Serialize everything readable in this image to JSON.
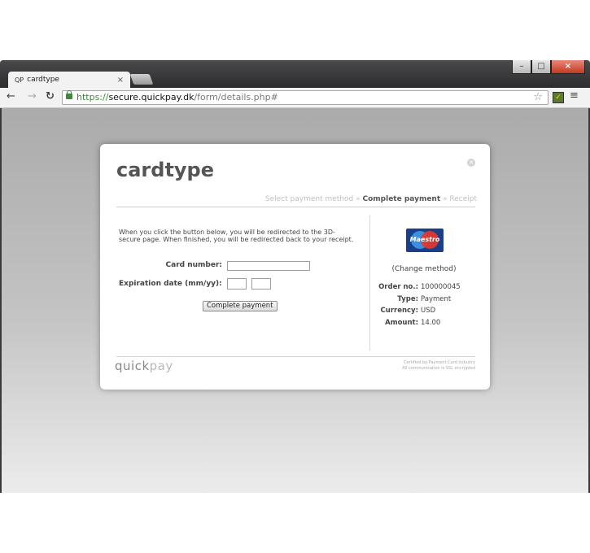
{
  "browser": {
    "tab_title": "cardtype",
    "tab_favicon": "QP",
    "tab_close": "×",
    "url_scheme": "https://",
    "url_host": "secure.quickpay.dk",
    "url_path": "/form/details.php#",
    "icons": [
      "back-arrow-icon",
      "forward-arrow-icon",
      "reload-icon",
      "lock-icon",
      "star-icon",
      "extension-icon",
      "menu-icon"
    ],
    "win_min": "–",
    "win_max": "□",
    "win_close": "×"
  },
  "dialog": {
    "title": "cardtype",
    "steps": {
      "step1": "Select payment method",
      "sep1": " » ",
      "step2": "Complete payment",
      "sep2": " » ",
      "step3": "Receipt"
    },
    "intro": "When you click the button below, you will be redirected to the 3D-secure page. When finished, you will be redirected back to your receipt.",
    "card_number_label": "Card number:",
    "expiration_label": "Expiration date (mm/yy):",
    "submit_label": "Complete payment",
    "card_brand": "Maestro",
    "change_method": "(Change method)",
    "details": [
      {
        "key": "Order no.:",
        "value": "100000045"
      },
      {
        "key": "Type:",
        "value": "Payment"
      },
      {
        "key": "Currency:",
        "value": "USD"
      },
      {
        "key": "Amount:",
        "value": "14.00"
      }
    ],
    "footer_logo_quick": "quick",
    "footer_logo_pay": "pay",
    "cert_line1": "Certified by Payment Card Industry",
    "cert_line2": "All communication is SSL encrypted"
  },
  "colors": {
    "secure_green": "#3d8a3a",
    "maestro_blue": "#1a3f8a",
    "maestro_red": "#e3372a"
  }
}
